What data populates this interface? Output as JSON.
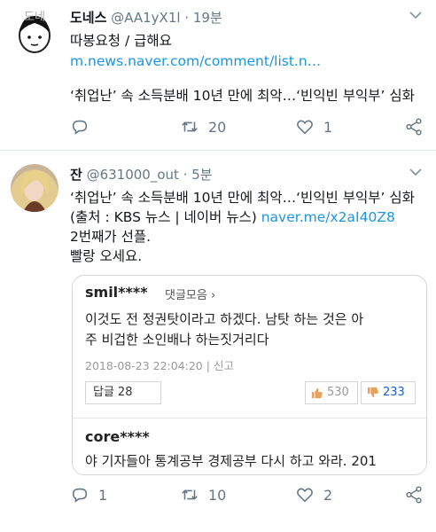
{
  "tweets": [
    {
      "avatar_label": "도네",
      "display_name": "도네스",
      "handle": "@AA1yX1l",
      "time": "19분",
      "lines": [
        "따봉요청 / 급해요",
        "m.news.naver.com/comment/list.n…",
        "‘취업난’ 속 소득분배 10년 만에 최악…‘빈익빈 부익부’ 심화"
      ],
      "actions": {
        "reply": "",
        "retweet": "20",
        "like": "1"
      }
    },
    {
      "display_name": "잔",
      "handle": "@631000_out",
      "time": "5분",
      "lines": [
        "‘취업난’ 속 소득분배 10년 만에 최악…‘빈익빈 부익부’ 심화",
        "(출처 : KBS 뉴스 | 네이버 뉴스) ",
        "naver.me/x2aI40Z8",
        "2번째가 선플.",
        "빨랑 오세요."
      ],
      "actions": {
        "reply": "1",
        "retweet": "10",
        "like": "2"
      },
      "comment": {
        "user": "smil****",
        "more": "댓글모음 ›",
        "text_line1": "이것도 전 정권탓이라고 하겠다. 남탓 하는 것은 아",
        "text_line2": "주 비겁한 소인배나 하는짓거리다",
        "date": "2018-08-23 22:04:20",
        "report": "신고",
        "reply_label": "답글",
        "reply_count": "28",
        "upvotes": "530",
        "downvotes": "233",
        "user2": "core****",
        "text_line3": "야 기자들아 통계공부 경제공부 다시 하고 와라. 201"
      }
    }
  ],
  "colors": {
    "link": "#1b95e0",
    "muted": "#657786",
    "downvote": "#1b5bd8"
  },
  "icons": [
    "caret-down-icon",
    "reply-icon",
    "retweet-icon",
    "like-icon",
    "share-icon",
    "thumbs-up-icon",
    "thumbs-down-icon"
  ]
}
